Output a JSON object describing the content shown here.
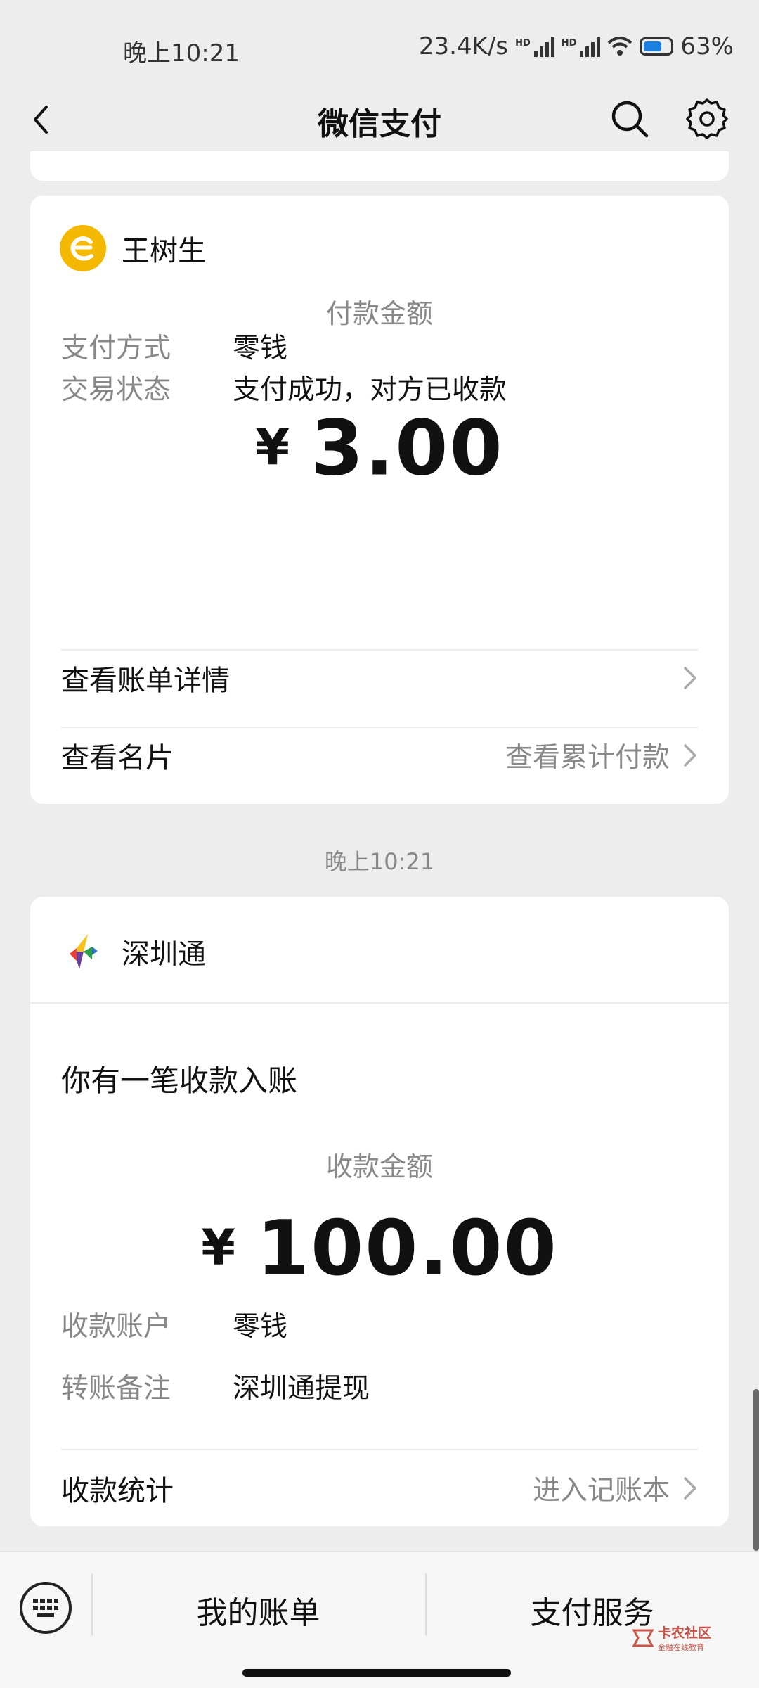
{
  "status_bar": {
    "time": "晚上10:21",
    "net_speed": "23.4K/s",
    "battery": "63%",
    "hd1": "HD",
    "hd2": "HD"
  },
  "nav": {
    "title": "微信支付"
  },
  "payment_card": {
    "merchant": "王树生",
    "amount_label": "付款金额",
    "currency": "¥",
    "amount": "3.00",
    "rows": [
      {
        "key": "支付方式",
        "value": "零钱"
      },
      {
        "key": "交易状态",
        "value": "支付成功，对方已收款"
      }
    ],
    "link_bill_detail": "查看账单详情",
    "link_card": "查看名片",
    "link_cumulative": "查看累计付款"
  },
  "time_separator": "晚上10:21",
  "receipt_card": {
    "merchant": "深圳通",
    "notice": "你有一笔收款入账",
    "amount_label": "收款金额",
    "currency": "¥",
    "amount": "100.00",
    "rows": [
      {
        "key": "收款账户",
        "value": "零钱"
      },
      {
        "key": "转账备注",
        "value": "深圳通提现"
      }
    ],
    "stats_label": "收款统计",
    "stats_link": "进入记账本"
  },
  "bottom_bar": {
    "my_bill": "我的账单",
    "pay_service": "支付服务"
  },
  "watermark": {
    "main": "卡农社区",
    "sub": "金融在线教育"
  },
  "colors": {
    "background": "#ededed",
    "card": "#ffffff",
    "merchant1_logo": "#f5b800",
    "battery_fill": "#1b7fe0"
  }
}
